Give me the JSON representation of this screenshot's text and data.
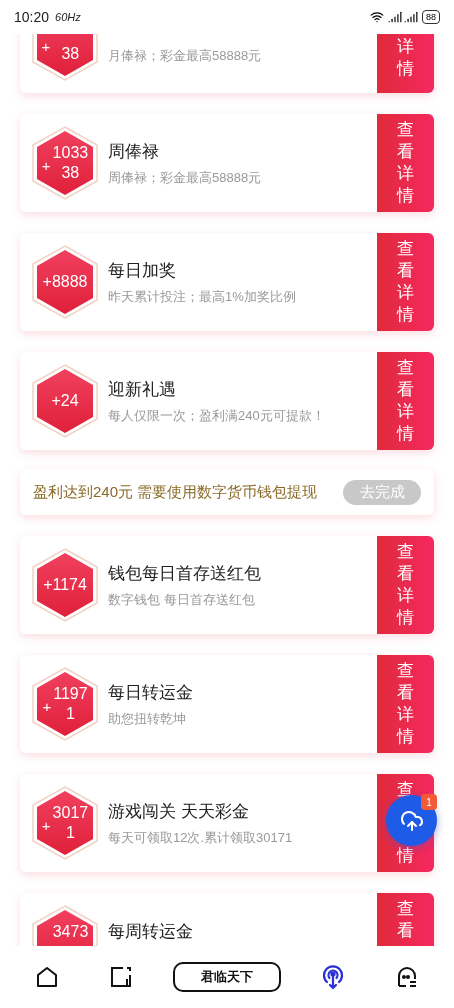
{
  "status_bar": {
    "time": "10:20",
    "refresh": "60Hz",
    "battery": "88"
  },
  "cards_before": [
    {
      "kind": "top_cut",
      "sign": "+",
      "amount_lines": [
        "38"
      ],
      "subtitle": "月俸禄；彩金最高58888元",
      "button": "详情"
    },
    {
      "sign": "+",
      "amount_lines": [
        "1033",
        "38"
      ],
      "title": "周俸禄",
      "subtitle": "周俸禄；彩金最高58888元",
      "button": "查看详情"
    },
    {
      "sign": "+",
      "amount_lines": [
        "8888"
      ],
      "title": "每日加奖",
      "subtitle": "昨天累计投注；最高1%加奖比例",
      "button": "查看详情"
    },
    {
      "sign": "+",
      "amount_lines": [
        "24"
      ],
      "title": "迎新礼遇",
      "subtitle": "每人仅限一次；盈利满240元可提款！",
      "button": "查看详情"
    }
  ],
  "notice": {
    "text": "盈利达到240元 需要使用数字货币钱包提现",
    "button": "去完成",
    "disabled": true
  },
  "cards_after": [
    {
      "sign": "+",
      "amount_lines": [
        "1174"
      ],
      "title": "钱包每日首存送红包",
      "subtitle": "数字钱包 每日首存送红包",
      "button": "查看详情"
    },
    {
      "sign": "+",
      "amount_lines": [
        "1197",
        "1"
      ],
      "title": "每日转运金",
      "subtitle": "助您扭转乾坤",
      "button": "查看详情"
    },
    {
      "sign": "+",
      "amount_lines": [
        "3017",
        "1"
      ],
      "title": "游戏闯关 天天彩金",
      "subtitle": "每天可领取12次.累计领取30171",
      "kind": "covered",
      "button": "查",
      "button_end": "情"
    },
    {
      "kind": "bottom_cut",
      "amount_lines": [
        "3473"
      ],
      "title": "每周转运金",
      "button": "查看"
    }
  ],
  "float_button": {
    "badge": "1"
  },
  "nav": [
    {
      "kind": "home",
      "selected": false
    },
    {
      "kind": "card",
      "selected": false
    },
    {
      "kind": "pill",
      "label": "君临天下",
      "selected": false
    },
    {
      "kind": "broadcast",
      "selected": true
    },
    {
      "kind": "ghost",
      "selected": false
    }
  ]
}
